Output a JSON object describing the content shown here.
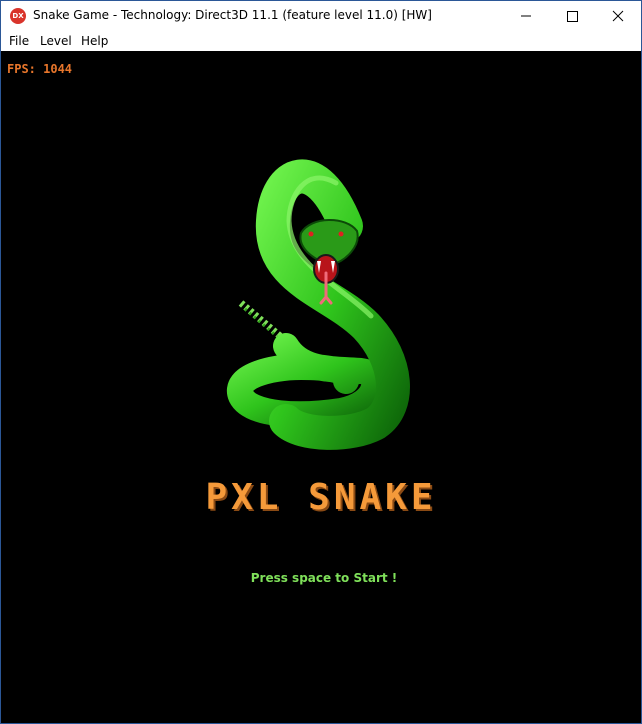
{
  "window": {
    "title": "Snake Game - Technology: Direct3D 11.1 (feature level 11.0) [HW]",
    "app_icon_text": "DX"
  },
  "menu": {
    "items": [
      {
        "label": "File"
      },
      {
        "label": "Level"
      },
      {
        "label": "Help"
      }
    ]
  },
  "game": {
    "fps_text": "FPS: 1044",
    "logo_text": "PXL SNAKE",
    "prompt_text": "Press space to Start !"
  },
  "colors": {
    "background": "#000000",
    "fps": "#e8762b",
    "logo": "#f59a3a",
    "prompt": "#7fe05a",
    "snake": "#2fc41c"
  }
}
